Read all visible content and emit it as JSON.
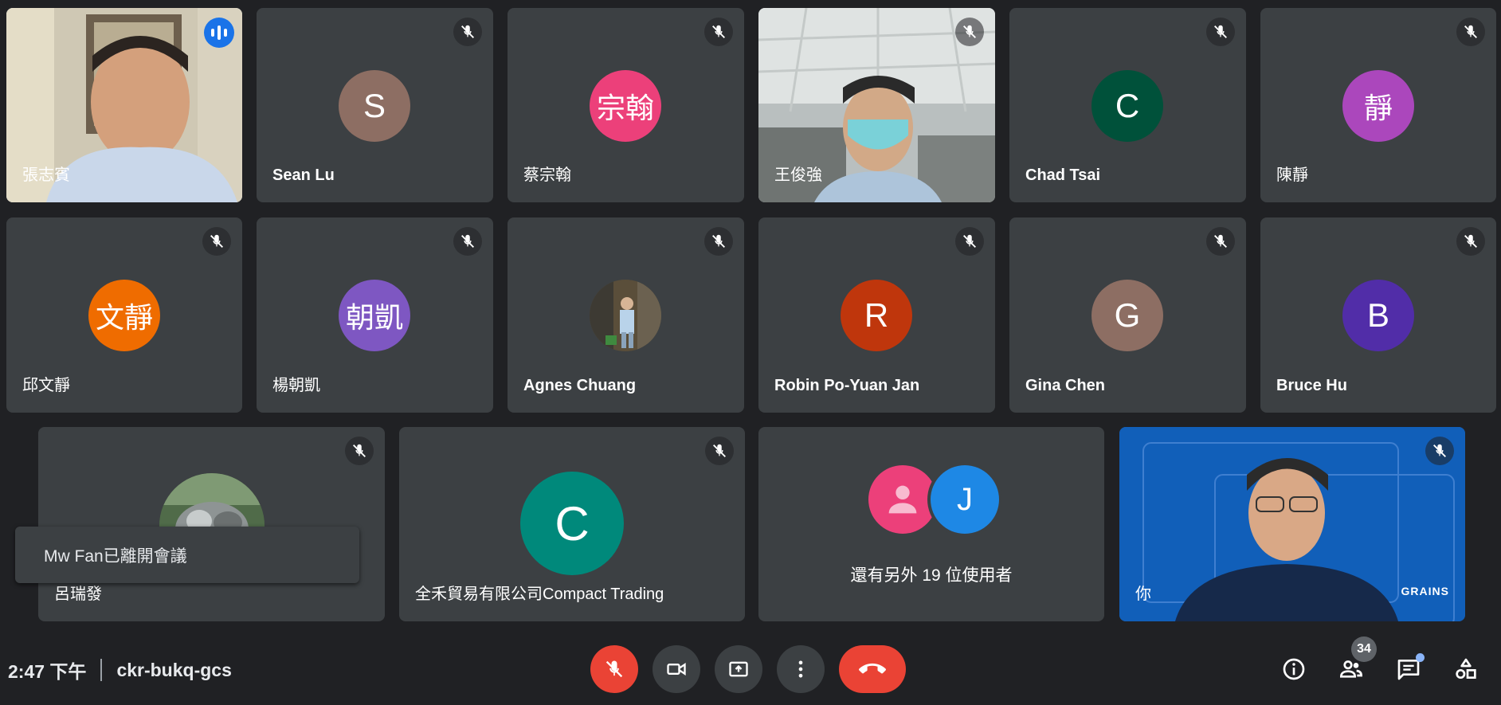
{
  "participants": {
    "p1": {
      "name": "張志賓"
    },
    "p2": {
      "name": "Sean Lu",
      "initial": "S",
      "color": "#8d6e63"
    },
    "p3": {
      "name": "蔡宗翰",
      "initial": "宗翰",
      "color": "#ec407a"
    },
    "p4": {
      "name": "王俊強"
    },
    "p5": {
      "name": "Chad Tsai",
      "initial": "C",
      "color": "#00513a"
    },
    "p6": {
      "name": "陳靜",
      "initial": "靜",
      "color": "#ab47bc"
    },
    "p7": {
      "name": "邱文靜",
      "initial": "文靜",
      "color": "#ef6c00"
    },
    "p8": {
      "name": "楊朝凱",
      "initial": "朝凱",
      "color": "#7e57c2"
    },
    "p9": {
      "name": "Agnes Chuang"
    },
    "p10": {
      "name": "Robin Po-Yuan Jan",
      "initial": "R",
      "color": "#bf360c"
    },
    "p11": {
      "name": "Gina Chen",
      "initial": "G",
      "color": "#8d6e63"
    },
    "p12": {
      "name": "Bruce Hu",
      "initial": "B",
      "color": "#512da8"
    },
    "p13": {
      "name": "呂瑞發"
    },
    "p14": {
      "name": "全禾貿易有限公司Compact Trading",
      "initial": "C",
      "color": "#00897b"
    },
    "others": {
      "label": "還有另外 19 位使用者",
      "initial": "J",
      "color": "#1e88e5",
      "avatar_color": "#ec407a"
    },
    "self": {
      "name": "你",
      "bg_text": "GRAINS"
    }
  },
  "toast": {
    "message": "Mw Fan已離開會議"
  },
  "bottom_bar": {
    "time": "2:47 下午",
    "meeting_code": "ckr-bukq-gcs",
    "participant_count": "34"
  },
  "icons": {
    "mic_off": "mic-off-icon",
    "speaking": "audio-wave-icon",
    "camera": "videocam-icon",
    "present": "present-screen-icon",
    "more": "more-vert-icon",
    "hangup": "call-end-icon",
    "info": "info-icon",
    "people": "people-icon",
    "chat": "chat-icon",
    "activities": "activities-icon"
  },
  "colors": {
    "background": "#202124",
    "tile": "#3c4043",
    "hangup": "#ea4335",
    "mic_off_button": "#ea4335",
    "speaking_outline": "#8ab4f8"
  }
}
